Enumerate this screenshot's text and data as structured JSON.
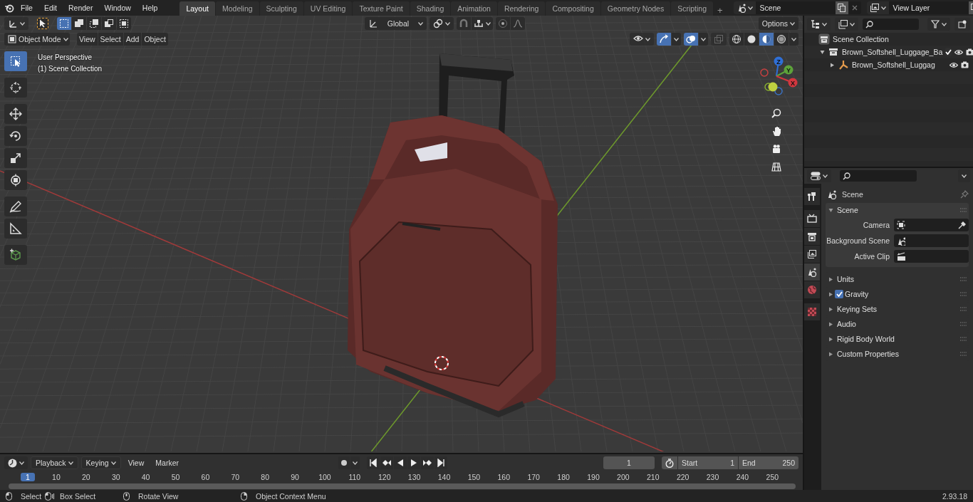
{
  "topbar": {
    "menus": [
      "File",
      "Edit",
      "Render",
      "Window",
      "Help"
    ],
    "workspaces": [
      {
        "label": "Layout",
        "selected": true
      },
      {
        "label": "Modeling",
        "selected": false
      },
      {
        "label": "Sculpting",
        "selected": false
      },
      {
        "label": "UV Editing",
        "selected": false
      },
      {
        "label": "Texture Paint",
        "selected": false
      },
      {
        "label": "Shading",
        "selected": false
      },
      {
        "label": "Animation",
        "selected": false
      },
      {
        "label": "Rendering",
        "selected": false
      },
      {
        "label": "Compositing",
        "selected": false
      },
      {
        "label": "Geometry Nodes",
        "selected": false
      },
      {
        "label": "Scripting",
        "selected": false
      }
    ],
    "add_tab": "+",
    "scene": "Scene",
    "view_layer": "View Layer"
  },
  "viewport": {
    "select_modes": [
      {
        "selected": true
      },
      {
        "selected": false
      },
      {
        "selected": false
      },
      {
        "selected": false
      },
      {
        "selected": false
      }
    ],
    "orientation": "Global",
    "options": "Options",
    "mode": "Object Mode",
    "menus": [
      "View",
      "Select",
      "Add",
      "Object"
    ],
    "shading": [
      {
        "kind": "wireframe",
        "selected": false
      },
      {
        "kind": "solid",
        "selected": false
      },
      {
        "kind": "material",
        "selected": true
      },
      {
        "kind": "rendered",
        "selected": false
      }
    ],
    "info": [
      "User Perspective",
      "(1) Scene Collection"
    ],
    "tools": [
      {
        "kind": "select",
        "selected": true
      },
      {
        "kind": "cursor",
        "selected": false
      },
      {
        "kind": "move",
        "selected": false
      },
      {
        "kind": "rotate",
        "selected": false
      },
      {
        "kind": "scale",
        "selected": false
      },
      {
        "kind": "transform",
        "selected": false
      },
      {
        "kind": "annotate",
        "selected": false
      },
      {
        "kind": "measure",
        "selected": false
      },
      {
        "kind": "cube",
        "selected": false
      }
    ],
    "gizmo_axes": [
      "Z",
      "Y",
      "X"
    ]
  },
  "outliner": {
    "items": [
      {
        "label": "Scene Collection",
        "kind": "scene",
        "children": [
          {
            "label": "Brown_Softshell_Luggage_Ba",
            "kind": "collection",
            "expanded": true,
            "checked": true,
            "children": [
              {
                "label": "Brown_Softshell_Luggag",
                "kind": "object",
                "expanded": false
              }
            ]
          }
        ]
      }
    ]
  },
  "properties": {
    "tabs": [
      {
        "kind": "tool",
        "selected": false
      },
      {
        "kind": "render",
        "selected": false
      },
      {
        "kind": "output",
        "selected": false
      },
      {
        "kind": "viewlayer",
        "selected": false
      },
      {
        "kind": "scene",
        "selected": true
      },
      {
        "kind": "world",
        "selected": false
      },
      {
        "kind": "texture",
        "selected": false
      }
    ],
    "context": "Scene",
    "panels": [
      {
        "title": "Scene",
        "expanded": true,
        "fields": [
          {
            "label": "Camera",
            "kind": "camera"
          },
          {
            "label": "Background Scene",
            "kind": "scene"
          },
          {
            "label": "Active Clip",
            "kind": "clip"
          }
        ]
      },
      {
        "title": "Units",
        "expanded": false
      },
      {
        "title": "Gravity",
        "expanded": false,
        "checked": true
      },
      {
        "title": "Keying Sets",
        "expanded": false
      },
      {
        "title": "Audio",
        "expanded": false
      },
      {
        "title": "Rigid Body World",
        "expanded": false
      },
      {
        "title": "Custom Properties",
        "expanded": false
      }
    ]
  },
  "timeline": {
    "menus": [
      {
        "label": "Playback",
        "kind": "dropdown"
      },
      {
        "label": "Keying",
        "kind": "dropdown"
      },
      {
        "label": "View",
        "kind": "menu"
      },
      {
        "label": "Marker",
        "kind": "menu"
      }
    ],
    "current_frame": "1",
    "start_label": "Start",
    "start": "1",
    "end_label": "End",
    "end": "250",
    "ruler": [
      {
        "label": "1",
        "selected": true
      },
      {
        "label": "10",
        "selected": false
      },
      {
        "label": "20",
        "selected": false
      },
      {
        "label": "30",
        "selected": false
      },
      {
        "label": "40",
        "selected": false
      },
      {
        "label": "50",
        "selected": false
      },
      {
        "label": "60",
        "selected": false
      },
      {
        "label": "70",
        "selected": false
      },
      {
        "label": "80",
        "selected": false
      },
      {
        "label": "90",
        "selected": false
      },
      {
        "label": "100",
        "selected": false
      },
      {
        "label": "110",
        "selected": false
      },
      {
        "label": "120",
        "selected": false
      },
      {
        "label": "130",
        "selected": false
      },
      {
        "label": "140",
        "selected": false
      },
      {
        "label": "150",
        "selected": false
      },
      {
        "label": "160",
        "selected": false
      },
      {
        "label": "170",
        "selected": false
      },
      {
        "label": "180",
        "selected": false
      },
      {
        "label": "190",
        "selected": false
      },
      {
        "label": "200",
        "selected": false
      },
      {
        "label": "210",
        "selected": false
      },
      {
        "label": "220",
        "selected": false
      },
      {
        "label": "230",
        "selected": false
      },
      {
        "label": "240",
        "selected": false
      },
      {
        "label": "250",
        "selected": false
      }
    ]
  },
  "status_bar": {
    "items": [
      {
        "label": "Select",
        "kind": "left"
      },
      {
        "label": "Box Select",
        "kind": "drag"
      },
      {
        "label": "Rotate View",
        "kind": "middle"
      },
      {
        "label": "Object Context Menu",
        "kind": "right"
      }
    ],
    "version": "2.93.18"
  }
}
